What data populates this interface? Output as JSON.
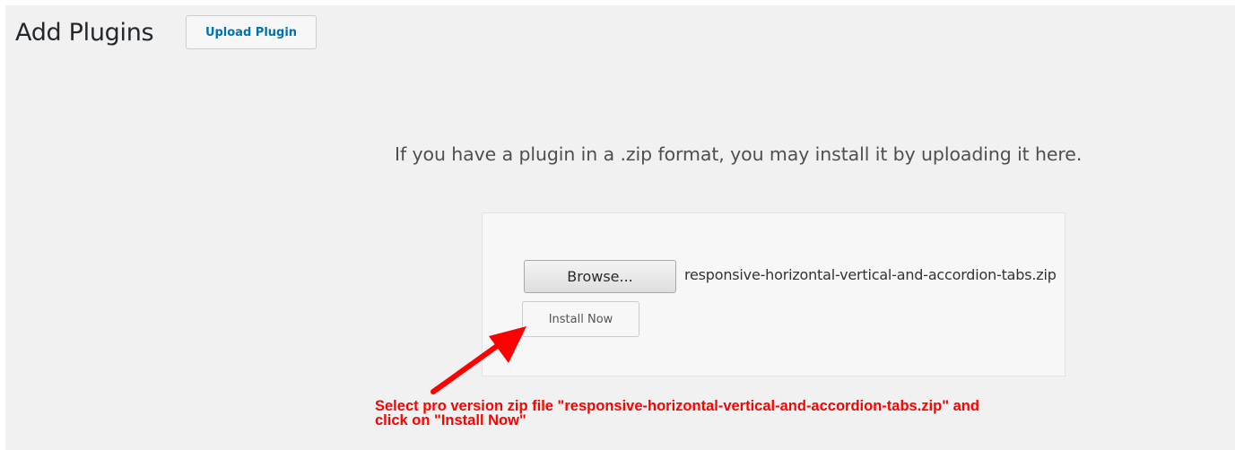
{
  "header": {
    "title": "Add Plugins",
    "upload_button_label": "Upload Plugin"
  },
  "upload": {
    "description": "If you have a plugin in a .zip format, you may install it by uploading it here.",
    "browse_label": "Browse...",
    "selected_file": "responsive-horizontal-vertical-and-accordion-tabs.zip",
    "install_label": "Install Now"
  },
  "annotation": {
    "line1": "Select pro version zip file \"responsive-horizontal-vertical-and-accordion-tabs.zip\" and",
    "line2": "click on \"Install Now\"",
    "color": "#ff0000"
  },
  "colors": {
    "page_background": "#f1f1f1",
    "link_accent": "#0073aa"
  }
}
